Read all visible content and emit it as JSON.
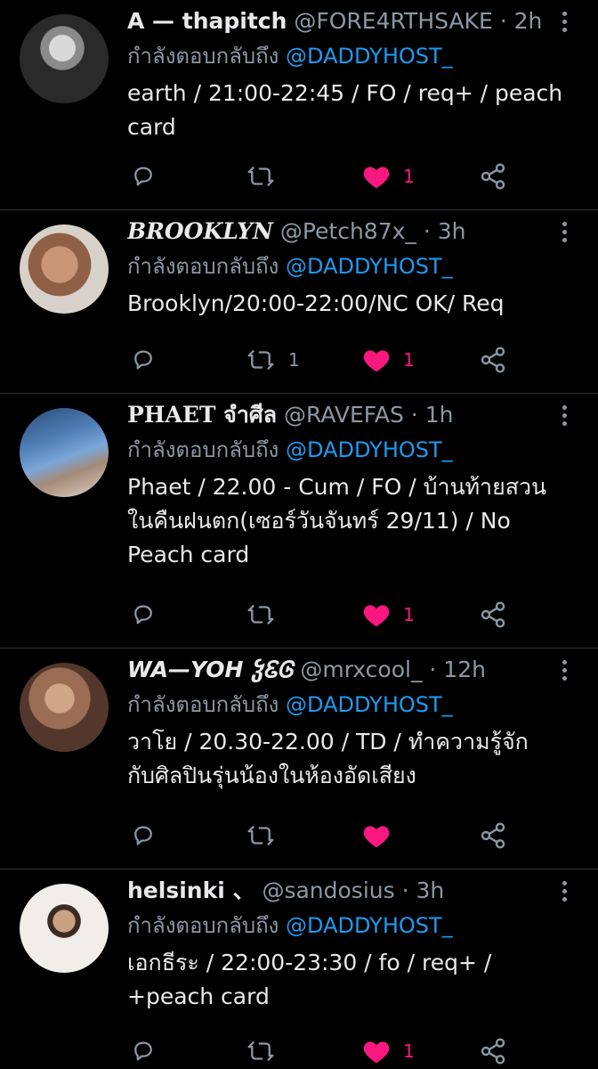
{
  "colors": {
    "background": "#000000",
    "text": "#e7e9ea",
    "muted": "#8b98a5",
    "mention": "#1d9bf0",
    "like": "#f91880",
    "divider": "#2f3336"
  },
  "icons": {
    "reply": "reply-icon",
    "retweet": "retweet-icon",
    "like": "heart-filled-icon",
    "share": "share-icon",
    "more": "more-vertical-icon"
  },
  "tweets": [
    {
      "name": "A — thapitch",
      "handle": "@FORE4RTHSAKE",
      "dot": " · ",
      "time": "2h",
      "replying_prefix": "กำลังตอบกลับถึง ",
      "replying_to": "@DADDYHOST_",
      "text": "earth / 21:00-22:45 / FO / req+ / peach\ncard",
      "retweets": "",
      "likes": "1"
    },
    {
      "name": "BROOKLYN",
      "handle": "@Petch87x_",
      "dot": " · ",
      "time": "3h",
      "replying_prefix": "กำลังตอบกลับถึง ",
      "replying_to": "@DADDYHOST_",
      "text": "Brooklyn/20:00-22:00/NC OK/ Req",
      "retweets": "1",
      "likes": "1"
    },
    {
      "name": "PHAET จำศีล",
      "handle": "@RAVEFAS",
      "dot": " · ",
      "time": "1h",
      "replying_prefix": "กำลังตอบกลับถึง ",
      "replying_to": "@DADDYHOST_",
      "text": "Phaet / 22.00 - Cum / FO / บ้านท้ายสวน\nในคืนฝนตก(เซอร์วันจันทร์ 29/11) / No\nPeach card",
      "retweets": "",
      "likes": "1"
    },
    {
      "name": "WA—YOH ჴᏋᎶ",
      "handle": "@mrxcool_",
      "dot": " · ",
      "time": "12h",
      "replying_prefix": "กำลังตอบกลับถึง ",
      "replying_to": "@DADDYHOST_",
      "text": "วาโย / 20.30-22.00 / TD / ทำความรู้จัก\nกับศิลปินรุ่นน้องในห้องอัดเสียง",
      "retweets": "",
      "likes": ""
    },
    {
      "name": "helsinki 、",
      "handle": "@sandosius",
      "dot": " · ",
      "time": "3h",
      "replying_prefix": "กำลังตอบกลับถึง ",
      "replying_to": "@DADDYHOST_",
      "text": "เอกธีระ / 22:00-23:30 / fo / req+ /\n+peach card",
      "retweets": "",
      "likes": "1"
    }
  ]
}
